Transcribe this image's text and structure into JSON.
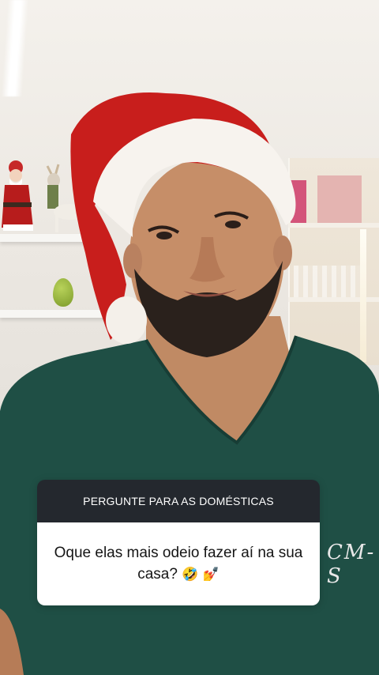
{
  "question_box": {
    "prompt": "PERGUNTE PARA AS DOMÉSTICAS",
    "question": "Oque elas mais odeio fazer aí na sua casa?",
    "emoji_1": "🤣",
    "emoji_2": "💅"
  },
  "photo": {
    "scrubs_logo_text": "CM-S"
  },
  "colors": {
    "scrubs": "#1f4f45",
    "hat_red": "#c81e1c",
    "prompt_header_bg": "#24282e"
  }
}
